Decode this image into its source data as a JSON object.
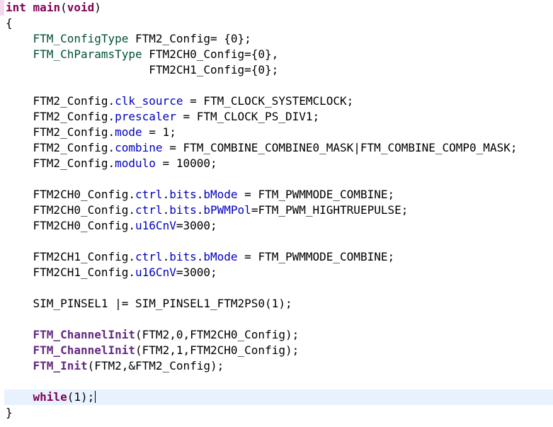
{
  "editor": {
    "current_line": 25,
    "lines": [
      [
        [
          "kw",
          "int"
        ],
        [
          "plain",
          " "
        ],
        [
          "kw",
          "main"
        ],
        [
          "plain",
          "("
        ],
        [
          "kw",
          "void"
        ],
        [
          "plain",
          ")"
        ]
      ],
      [
        [
          "plain",
          "{"
        ]
      ],
      [
        [
          "plain",
          "    "
        ],
        [
          "type",
          "FTM_ConfigType"
        ],
        [
          "plain",
          " FTM2_Config= {0};"
        ]
      ],
      [
        [
          "plain",
          "    "
        ],
        [
          "type",
          "FTM_ChParamsType"
        ],
        [
          "plain",
          " FTM2CH0_Config={0},"
        ]
      ],
      [
        [
          "plain",
          "                     FTM2CH1_Config={0};"
        ]
      ],
      [],
      [
        [
          "plain",
          "    FTM2_Config."
        ],
        [
          "field",
          "clk_source"
        ],
        [
          "plain",
          " = FTM_CLOCK_SYSTEMCLOCK;"
        ]
      ],
      [
        [
          "plain",
          "    FTM2_Config."
        ],
        [
          "field",
          "prescaler"
        ],
        [
          "plain",
          " = FTM_CLOCK_PS_DIV1;"
        ]
      ],
      [
        [
          "plain",
          "    FTM2_Config."
        ],
        [
          "field",
          "mode"
        ],
        [
          "plain",
          " = 1;"
        ]
      ],
      [
        [
          "plain",
          "    FTM2_Config."
        ],
        [
          "field",
          "combine"
        ],
        [
          "plain",
          " = FTM_COMBINE_COMBINE0_MASK|FTM_COMBINE_COMP0_MASK;"
        ]
      ],
      [
        [
          "plain",
          "    FTM2_Config."
        ],
        [
          "field",
          "modulo"
        ],
        [
          "plain",
          " = 10000;"
        ]
      ],
      [],
      [
        [
          "plain",
          "    FTM2CH0_Config."
        ],
        [
          "field",
          "ctrl"
        ],
        [
          "plain",
          "."
        ],
        [
          "field",
          "bits"
        ],
        [
          "plain",
          "."
        ],
        [
          "field",
          "bMode"
        ],
        [
          "plain",
          " = FTM_PWMMODE_COMBINE;"
        ]
      ],
      [
        [
          "plain",
          "    FTM2CH0_Config."
        ],
        [
          "field",
          "ctrl"
        ],
        [
          "plain",
          "."
        ],
        [
          "field",
          "bits"
        ],
        [
          "plain",
          "."
        ],
        [
          "field",
          "bPWMPol"
        ],
        [
          "plain",
          "=FTM_PWM_HIGHTRUEPULSE;"
        ]
      ],
      [
        [
          "plain",
          "    FTM2CH0_Config."
        ],
        [
          "field",
          "u16CnV"
        ],
        [
          "plain",
          "=3000;"
        ]
      ],
      [],
      [
        [
          "plain",
          "    FTM2CH1_Config."
        ],
        [
          "field",
          "ctrl"
        ],
        [
          "plain",
          "."
        ],
        [
          "field",
          "bits"
        ],
        [
          "plain",
          "."
        ],
        [
          "field",
          "bMode"
        ],
        [
          "plain",
          " = FTM_PWMMODE_COMBINE;"
        ]
      ],
      [
        [
          "plain",
          "    FTM2CH1_Config."
        ],
        [
          "field",
          "u16CnV"
        ],
        [
          "plain",
          "=3000;"
        ]
      ],
      [],
      [
        [
          "plain",
          "    SIM_PINSEL1 |= SIM_PINSEL1_FTM2PS0(1);"
        ]
      ],
      [],
      [
        [
          "plain",
          "    "
        ],
        [
          "func",
          "FTM_ChannelInit"
        ],
        [
          "plain",
          "(FTM2,0,FTM2CH0_Config);"
        ]
      ],
      [
        [
          "plain",
          "    "
        ],
        [
          "func",
          "FTM_ChannelInit"
        ],
        [
          "plain",
          "(FTM2,1,FTM2CH0_Config);"
        ]
      ],
      [
        [
          "plain",
          "    "
        ],
        [
          "func",
          "FTM_Init"
        ],
        [
          "plain",
          "(FTM2,&FTM2_Config);"
        ]
      ],
      [],
      [
        [
          "plain",
          "    "
        ],
        [
          "kw",
          "while"
        ],
        [
          "plain",
          "(1);"
        ]
      ],
      [
        [
          "plain",
          "}"
        ]
      ]
    ]
  }
}
